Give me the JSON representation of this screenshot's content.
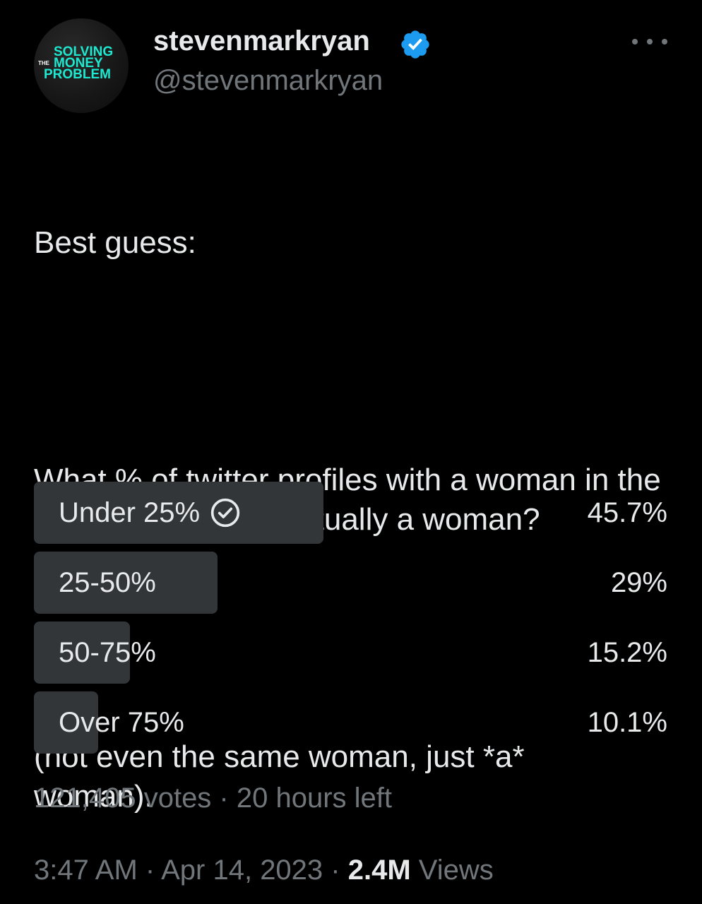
{
  "author": {
    "display_name": "stevenmarkryan",
    "handle": "@stevenmarkryan",
    "avatar_logo": [
      "SOLVING",
      "THE",
      "MONEY",
      "PROBLEM"
    ],
    "verified_icon": "verified-badge-icon",
    "more_icon": "more-horizontal-icon"
  },
  "tweet": {
    "paragraphs": [
      "Best guess:",
      "What % of twitter profiles with a woman in the profile picture are actually a woman?",
      "(not even the same woman, just *a* woman)."
    ]
  },
  "poll": {
    "options": [
      {
        "label": "Under 25%",
        "percent_text": "45.7%",
        "percent": 45.7,
        "winner": true
      },
      {
        "label": "25-50%",
        "percent_text": "29%",
        "percent": 29,
        "winner": false
      },
      {
        "label": "50-75%",
        "percent_text": "15.2%",
        "percent": 15.2,
        "winner": false
      },
      {
        "label": "Over 75%",
        "percent_text": "10.1%",
        "percent": 10.1,
        "winner": false
      }
    ],
    "votes": "121,405 votes",
    "separator": " · ",
    "time_left": "20 hours left"
  },
  "meta": {
    "time": "3:47 AM",
    "date": "Apr 14, 2023",
    "separator": " · ",
    "views_count": "2.4M",
    "views_label": "Views"
  },
  "colors": {
    "background": "#000000",
    "text_primary": "#e7e9ea",
    "text_secondary": "#71767b",
    "poll_bar": "#333639",
    "verified_blue": "#1d9bf0",
    "logo_teal": "#1de9d0"
  }
}
